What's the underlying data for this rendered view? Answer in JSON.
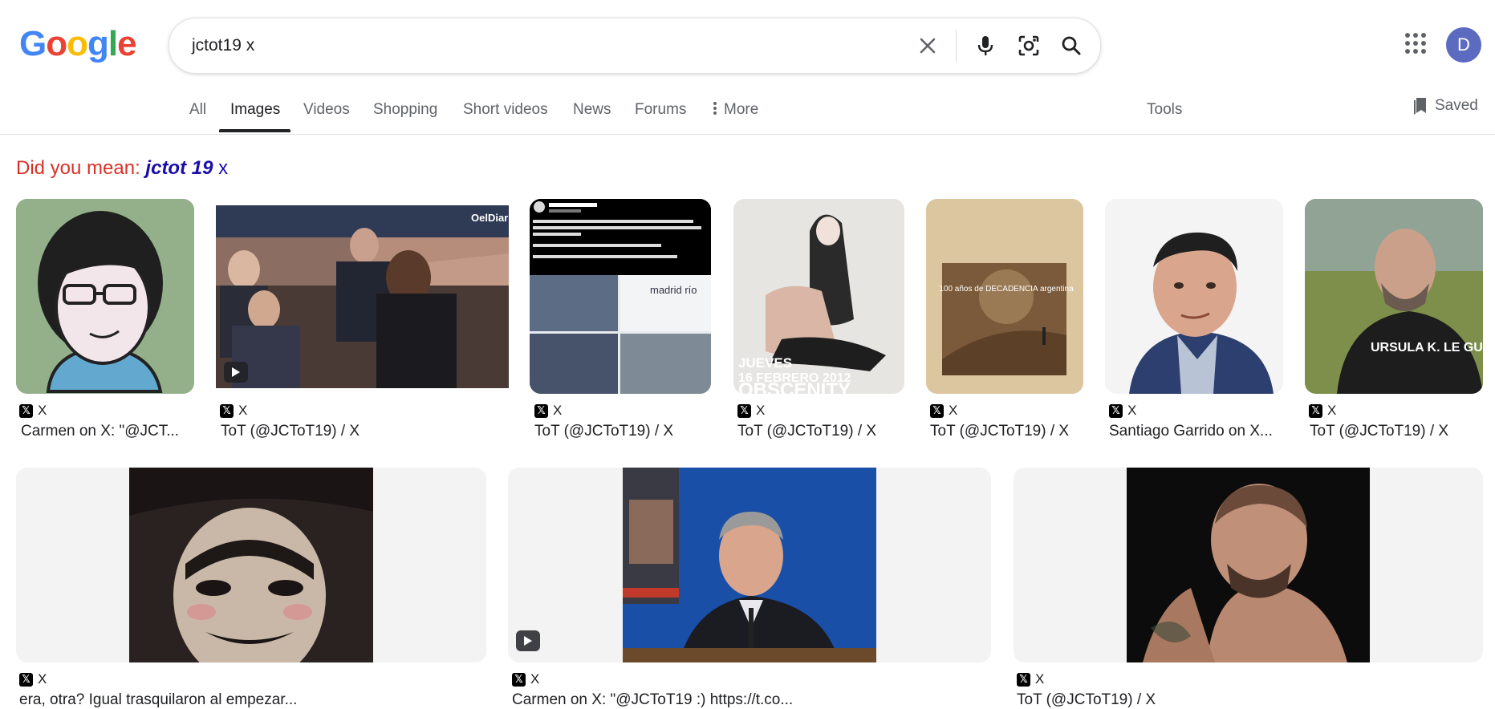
{
  "logo": {
    "letters": [
      "G",
      "o",
      "o",
      "g",
      "l",
      "e"
    ],
    "colors": [
      "#4285f4",
      "#ea4335",
      "#fbbc05",
      "#4285f4",
      "#34a853",
      "#ea4335"
    ]
  },
  "search": {
    "query": "jctot19 x"
  },
  "account": {
    "initial": "D",
    "color": "#5c6bc0"
  },
  "tabs": [
    {
      "label": "All"
    },
    {
      "label": "Images"
    },
    {
      "label": "Videos"
    },
    {
      "label": "Shopping"
    },
    {
      "label": "Short videos"
    },
    {
      "label": "News"
    },
    {
      "label": "Forums"
    },
    {
      "label": "More"
    }
  ],
  "tools_label": "Tools",
  "saved_label": "Saved",
  "did_you_mean": {
    "prefix": "Did you mean:",
    "suggestion": "jctot 19",
    "rest": "x"
  },
  "results": [
    {
      "source": "X",
      "title": "Carmen on X: \"@JCT..."
    },
    {
      "source": "X",
      "title": "ToT (@JCToT19) / X"
    },
    {
      "source": "X",
      "title": "ToT (@JCToT19) / X"
    },
    {
      "source": "X",
      "title": "ToT (@JCToT19) / X"
    },
    {
      "source": "X",
      "title": "ToT (@JCToT19) / X"
    },
    {
      "source": "X",
      "title": "Santiago Garrido on X..."
    },
    {
      "source": "X",
      "title": "ToT (@JCToT19) / X"
    },
    {
      "source": "X",
      "title": "era, otra? Igual trasquilaron al empezar..."
    },
    {
      "source": "X",
      "title": "Carmen on X: \"@JCToT19 :) https://t.co..."
    },
    {
      "source": "X",
      "title": "ToT (@JCToT19) / X"
    }
  ],
  "image_texts": {
    "oeldiario": "OelDiario",
    "jueves": "JUEVES",
    "fecha": "16 FEBRERO 2012",
    "obscenity": "OBSCENITY",
    "decadencia": "100 años de DECADENCIA argentina",
    "shirt": "URSULA K. LE GUIN",
    "hm": "madrid río"
  }
}
